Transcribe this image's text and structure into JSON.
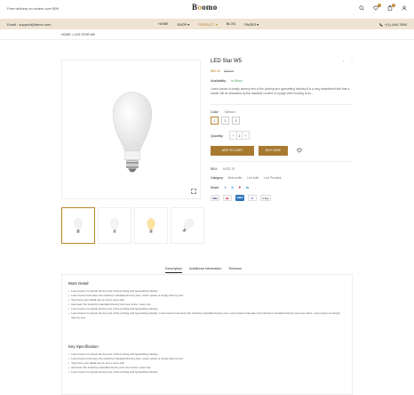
{
  "topbar": {
    "promo": "Free delivery on orders over $99",
    "logo_prefix": "B",
    "logo_o": "o",
    "logo_suffix": "omo",
    "wishlist_count": "0",
    "cart_count": "0"
  },
  "navbar": {
    "email": "Email : support@demo.com",
    "menu": [
      "HOME",
      "SHOP ▾",
      "PRODUCT ▾",
      "BLOG",
      "PAGES ▾"
    ],
    "active_index": 2,
    "phone": "+(1)-456-7890"
  },
  "breadcrumb": "HOME  >  LED STAR W5",
  "product": {
    "title": "LED Star W5",
    "price": "$89.00",
    "old_price": "$99.00",
    "availability_label": "Availability:",
    "availability_value": "In Stock",
    "description": "Lorem Ipsum is simply dummy text of the printing and typesetting industry.It is a long established fact that a reader will be distracted by the readable content of a page when looking at its...",
    "color_label": "Color:",
    "color_value": "Salmon",
    "swatches": [
      "1",
      "2",
      "3"
    ],
    "quantity_label": "Quantity:",
    "quantity": "1",
    "add_to_cart": "ADD TO CART",
    "buy_now": "BUY NOW",
    "sku_label": "SKU:",
    "sku_value": "#LED-76",
    "category_label": "Category:",
    "categories": [
      "Best seller,",
      "Led bulb,",
      "Led Pendant"
    ],
    "share_label": "Share:",
    "share_icons": [
      "f",
      "𝕏",
      "P",
      "in"
    ],
    "payments": [
      "VISA",
      "MC",
      "AMEX",
      "P",
      "G Pay"
    ]
  },
  "tabs": [
    "Description",
    "Additional information",
    "Reviews"
  ],
  "details": {
    "more_title": "More Detail",
    "more_items": [
      "Lorem Ipsum is simply dummy text of the printing and typesetting industry.",
      "Lorem Ipsum has been the industry's standard dummy text. Lorem Ipsum is simply dummy text.",
      "Type here your detail one by one li more add.",
      "Has been the industry's standard dummy text ever since. Lorem Ips",
      "Lorem Ipsum is simply dummy text of the printing and typesetting industry.",
      "Lorem Ipsum is simply dummy text of the printing and typesetting industry. Lorem Ipsum has been the industry's standard dummy text. Lorem Ipsum has been the industry's standard dummy text ever since. Lorem Ipsum is simply dummy text."
    ],
    "key_title": "Key Specification",
    "key_items": [
      "Lorem Ipsum is simply dummy text of the printing and typesetting industry.",
      "Lorem Ipsum has been the industry's standard dummy text. Lorem Ipsum is simply dummy text.",
      "Type here your detail one by one li more add.",
      "Has been the industry's standard dummy text ever since. Lorem Ips",
      "Lorem Ipsum is simply dummy text of the printing and typesetting industry."
    ]
  },
  "colors": {
    "accent": "#b8862b",
    "nav_bg": "#efe3d3",
    "button": "#a87a31",
    "in_stock": "#3aa655"
  }
}
